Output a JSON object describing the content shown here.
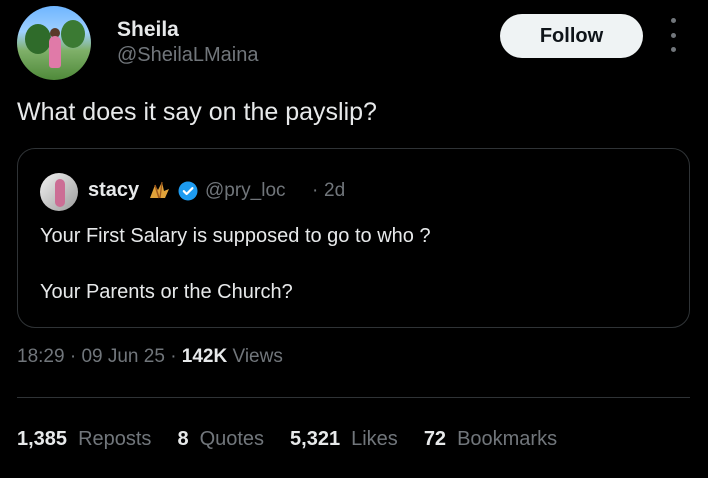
{
  "author": {
    "name": "Sheila",
    "handle": "@SheilaLMaina",
    "follow_label": "Follow"
  },
  "tweet": {
    "text": "What does it say on the payslip?"
  },
  "quoted": {
    "name": "stacy",
    "handle": "@pry_loc",
    "separator": "·",
    "time": "2d",
    "line1": "Your First Salary is supposed to go to who ?",
    "line2": "Your Parents or the Church?",
    "emoji_icon": "maple-leaf-icon",
    "verified_icon": "verified-badge-icon"
  },
  "meta": {
    "time": "18:29",
    "sep1": "·",
    "date": "09 Jun 25",
    "sep2": "·",
    "views_count": "142K",
    "views_label": "Views"
  },
  "stats": [
    {
      "num": "1,385",
      "label": "Reposts"
    },
    {
      "num": "8",
      "label": "Quotes"
    },
    {
      "num": "5,321",
      "label": "Likes"
    },
    {
      "num": "72",
      "label": "Bookmarks"
    }
  ],
  "colors": {
    "background": "#000000",
    "text_primary": "#e7e9ea",
    "text_secondary": "#71767b",
    "border": "#2f3336",
    "follow_bg": "#eff3f4",
    "verified": "#1d9bf0"
  }
}
